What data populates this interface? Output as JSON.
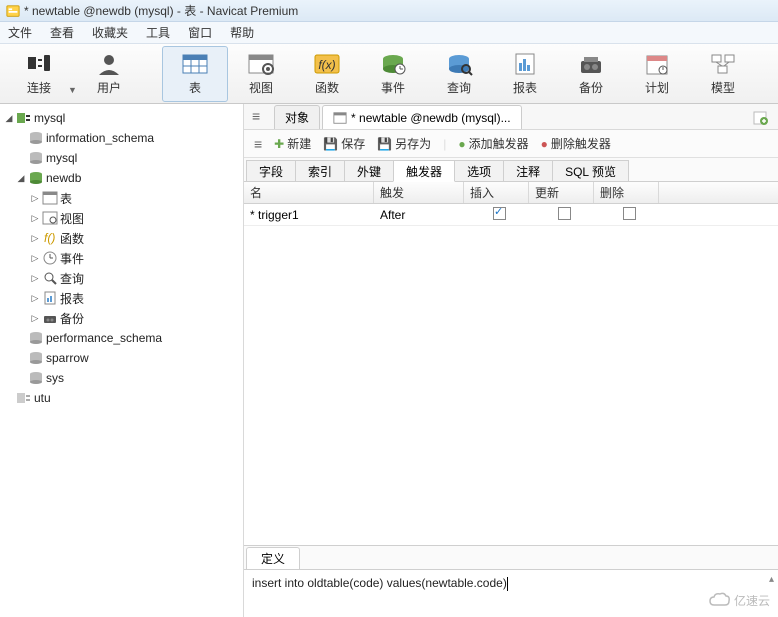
{
  "title": "* newtable @newdb (mysql) - 表 - Navicat Premium",
  "menus": [
    "文件",
    "查看",
    "收藏夹",
    "工具",
    "窗口",
    "帮助"
  ],
  "toolbar": [
    {
      "label": "连接",
      "icon": "plug"
    },
    {
      "label": "用户",
      "icon": "user"
    },
    {
      "label": "表",
      "icon": "table",
      "active": true
    },
    {
      "label": "视图",
      "icon": "view"
    },
    {
      "label": "函数",
      "icon": "fx"
    },
    {
      "label": "事件",
      "icon": "event"
    },
    {
      "label": "查询",
      "icon": "query"
    },
    {
      "label": "报表",
      "icon": "report"
    },
    {
      "label": "备份",
      "icon": "backup"
    },
    {
      "label": "计划",
      "icon": "schedule"
    },
    {
      "label": "模型",
      "icon": "model"
    }
  ],
  "tree": {
    "mysql": {
      "label": "mysql",
      "children": {
        "information_schema": "information_schema",
        "mysql": "mysql",
        "newdb": {
          "label": "newdb",
          "children": [
            {
              "label": "表",
              "icon": "table"
            },
            {
              "label": "视图",
              "icon": "view"
            },
            {
              "label": "函数",
              "icon": "fx"
            },
            {
              "label": "事件",
              "icon": "event"
            },
            {
              "label": "查询",
              "icon": "query"
            },
            {
              "label": "报表",
              "icon": "report"
            },
            {
              "label": "备份",
              "icon": "backup"
            }
          ]
        },
        "performance_schema": "performance_schema",
        "sparrow": "sparrow",
        "sys": "sys"
      }
    },
    "utu": "utu"
  },
  "tabs": {
    "t0": "对象",
    "t1": "* newtable @newdb (mysql)..."
  },
  "actionbar": {
    "menu": "≡",
    "new": "新建",
    "save": "保存",
    "saveas": "另存为",
    "addtrig": "添加触发器",
    "deltrig": "删除触发器"
  },
  "subtabs": [
    "字段",
    "索引",
    "外键",
    "触发器",
    "选项",
    "注释",
    "SQL 预览"
  ],
  "grid": {
    "headers": {
      "name": "名",
      "trigger": "触发",
      "insert": "插入",
      "update": "更新",
      "delete": "删除"
    },
    "rows": [
      {
        "marker": "*",
        "name": "trigger1",
        "trigger": "After",
        "insert": true,
        "update": false,
        "delete": false
      }
    ]
  },
  "def_tab": "定义",
  "def_text": "insert into oldtable(code) values(newtable.code)",
  "watermark": "亿速云"
}
